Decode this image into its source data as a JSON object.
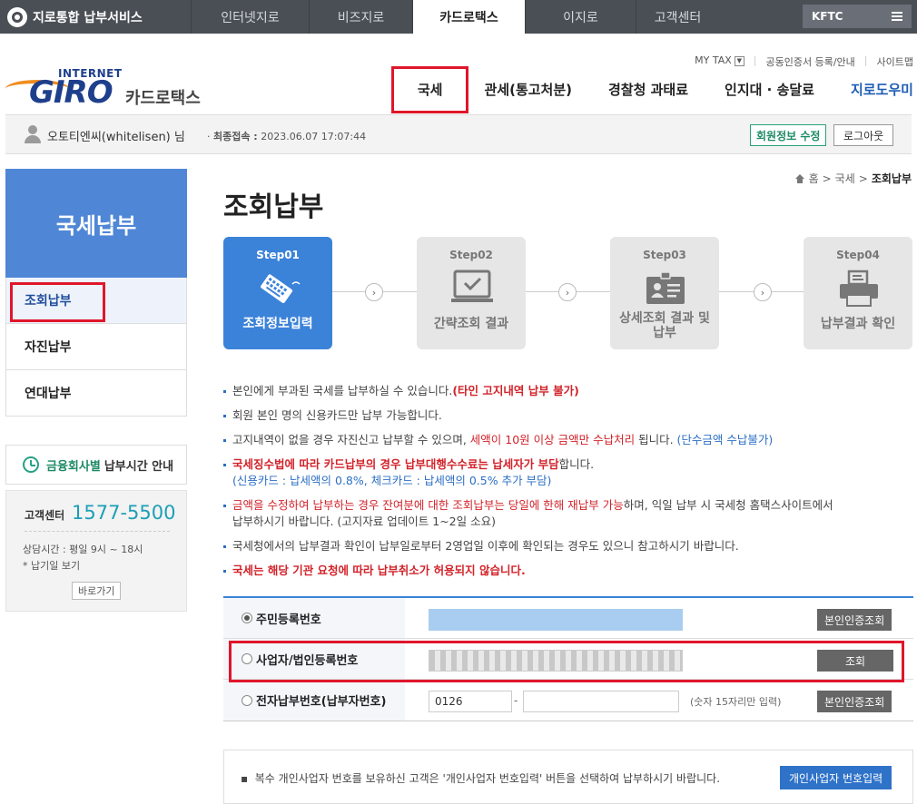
{
  "topnav": {
    "brand": "지로통합 납부서비스",
    "tabs": [
      "인터넷지로",
      "비즈지로",
      "카드로택스",
      "이지로",
      "고객센터"
    ],
    "active_tab": "카드로택스",
    "kftc": "KFTC"
  },
  "header": {
    "util": {
      "mytax": "MY TAX",
      "cert": "공동인증서 등록/안내",
      "sitemap": "사이트맵"
    },
    "logo": {
      "internet": "INTERNET",
      "giro": "GIRO",
      "service": "카드로택스"
    },
    "menu": [
      "국세",
      "관세(통고처분)",
      "경찰청 과태료",
      "인지대 · 송달료",
      "지로도우미"
    ]
  },
  "userbar": {
    "name": "오토티엔씨(whitelisen) 님",
    "last_login_label": "최종접속 :",
    "last_login": "2023.06.07 17:07:44",
    "edit_button": "회원정보 수정",
    "logout_button": "로그아웃"
  },
  "sidebar": {
    "title": "국세납부",
    "items": [
      "조회납부",
      "자진납부",
      "연대납부"
    ],
    "time_info": {
      "highlight": "금융회사별",
      "rest": "납부시간 안내"
    },
    "cs": {
      "label": "고객센터",
      "number": "1577-5500",
      "hours": "상담시간 : 평일 9시 ~ 18시",
      "holiday": "* 납기일 보기",
      "go": "바로가기"
    }
  },
  "breadcrumb": {
    "home": "홈",
    "level1": "국세",
    "current": "조회납부"
  },
  "page_title": "조회납부",
  "steps": [
    {
      "num": "Step01",
      "label": "조회정보입력",
      "icon": "keyboard-icon"
    },
    {
      "num": "Step02",
      "label": "간략조회 결과",
      "icon": "monitor-check-icon"
    },
    {
      "num": "Step03",
      "label": "상세조회 결과 및 납부",
      "icon": "id-card-icon"
    },
    {
      "num": "Step04",
      "label": "납부결과 확인",
      "icon": "printer-icon"
    }
  ],
  "notes": {
    "n1_a": "본인에게 부과된 국세를 납부하실 수 있습니다.",
    "n1_b": "(타인 고지내역 납부 불가)",
    "n2": "회원 본인 명의 신용카드만 납부 가능합니다.",
    "n3_a": "고지내역이 없을 경우 자진신고 납부할 수 있으며, ",
    "n3_b": "세액이 10원 이상 금액만 수납처리",
    "n3_c": " 됩니다. ",
    "n3_d": "(단수금액 수납불가)",
    "n4_a": "국세징수법에 따라 카드납부의 경우 납부대행수수료는 납세자가 부담",
    "n4_b": "합니다.",
    "n4_sub": "(신용카드 : 납세액의 0.8%, 체크카드 : 납세액의 0.5% 추가 부담)",
    "n5_a": "금액을 수정하여 납부하는 경우 잔여분에 대한 조회납부는 당일에 한해 재납부 가능",
    "n5_b": "하며, 익일 납부 시 국세청 홈택스사이트에서",
    "n5_c": "납부하시기 바랍니다. (고지자료 업데이트 1~2일 소요)",
    "n6": "국세청에서의 납부결과 확인이 납부일로부터 2영업일 이후에 확인되는 경우도 있으니 참고하시기 바랍니다.",
    "n7": "국세는 해당 기관 요청에 따라 납부취소가 허용되지 않습니다."
  },
  "form": {
    "row1": {
      "label": "주민등록번호",
      "button": "본인인증조회"
    },
    "row2": {
      "label": "사업자/법인등록번호",
      "button": "조회"
    },
    "row3": {
      "label": "전자납부번호(납부자번호)",
      "prefix": "0126",
      "hint": "(숫자 15자리만 입력)",
      "button": "본인인증조회"
    }
  },
  "bottom": {
    "text": "복수 개인사업자 번호를 보유하신 고객은 '개인사업자 번호입력' 버튼을 선택하여 납부하시기 바랍니다.",
    "button": "개인사업자 번호입력"
  },
  "colors": {
    "accent_blue": "#3b82d9",
    "highlight_red": "#e0162b",
    "green": "#1d8a66"
  }
}
